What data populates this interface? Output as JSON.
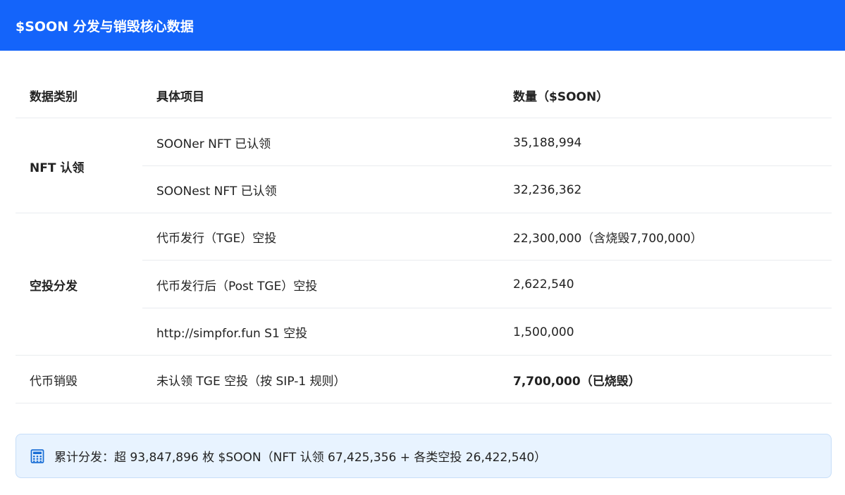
{
  "header": {
    "title": "$SOON 分发与销毁核心数据"
  },
  "table": {
    "columns": [
      "数据类别",
      "具体项目",
      "数量（$SOON）"
    ],
    "groups": [
      {
        "category": "NFT 认领",
        "rows": [
          {
            "item": "SOONer NFT 已认领",
            "amount": "35,188,994"
          },
          {
            "item": "SOONest NFT 已认领",
            "amount": "32,236,362"
          }
        ]
      },
      {
        "category": "空投分发",
        "rows": [
          {
            "item": "代币发行（TGE）空投",
            "amount": "22,300,000（含烧毁7,700,000）"
          },
          {
            "item": "代币发行后（Post TGE）空投",
            "amount": "2,622,540"
          },
          {
            "item": "http://simpfor.fun S1 空投",
            "amount": "1,500,000"
          }
        ]
      },
      {
        "category": "代币销毁",
        "rows": [
          {
            "item": "未认领 TGE 空投（按 SIP-1 规则）",
            "amount": "7,700,000（已烧毁）"
          }
        ]
      }
    ]
  },
  "summary": {
    "icon": "calculator-icon",
    "text": "累计分发：超 93,847,896 枚 $SOON（NFT 认领 67,425,356 + 各类空投 26,422,540）"
  },
  "colors": {
    "header_bg": "#1464fa",
    "summary_bg": "#e8f3ff",
    "summary_border": "#c7def8",
    "icon": "#1a6fd6"
  }
}
